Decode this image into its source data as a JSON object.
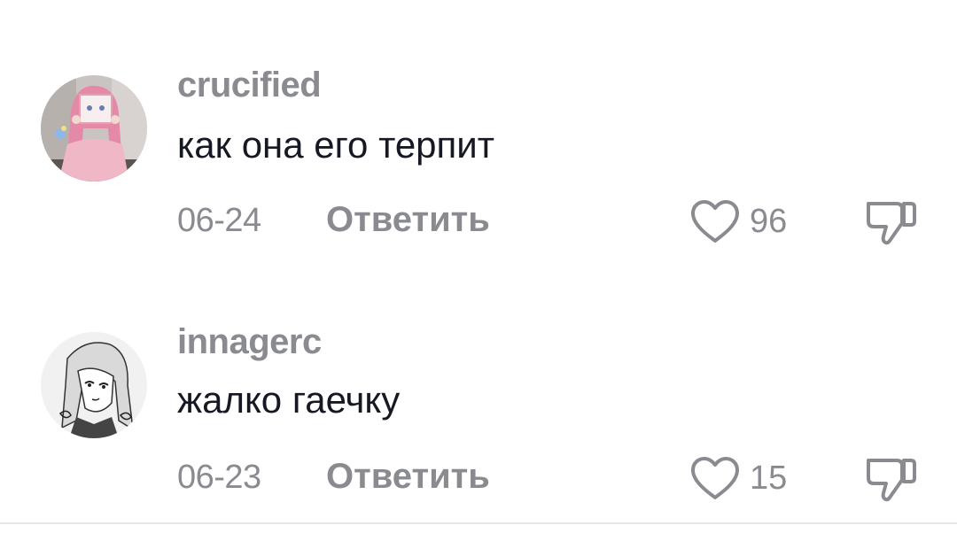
{
  "comments": [
    {
      "username": "crucified",
      "text": "как она его терпит",
      "date": "06-24",
      "reply_label": "Ответить",
      "likes": "96",
      "avatar_icon": "anime-girl-pink-hair-avatar"
    },
    {
      "username": "innagerc",
      "text": "жалко гаечку",
      "date": "06-23",
      "reply_label": "Ответить",
      "likes": "15",
      "avatar_icon": "manga-girl-sketch-avatar"
    }
  ],
  "colors": {
    "secondary_text": "#8a8b91",
    "primary_text": "#161823",
    "background": "#ffffff"
  }
}
